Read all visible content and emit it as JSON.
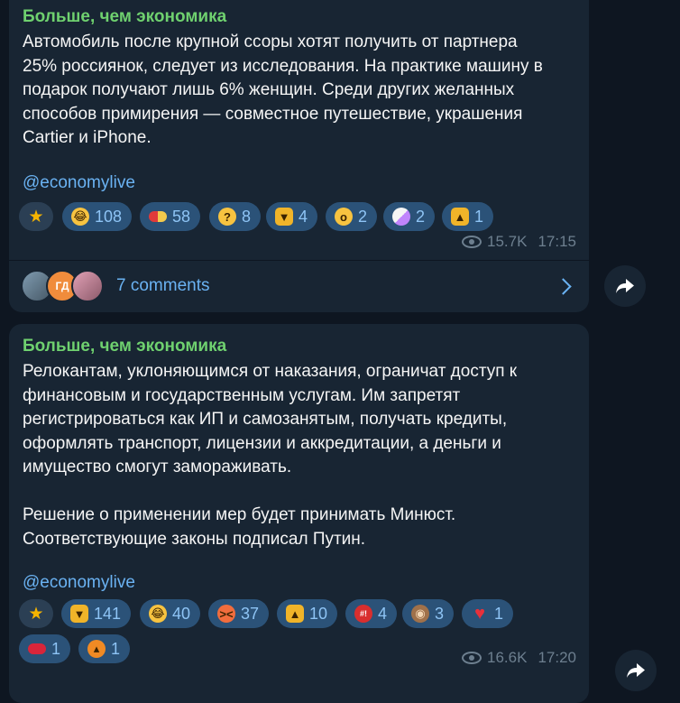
{
  "messages": [
    {
      "sender": "Больше, чем экономика",
      "text": "Автомобиль после крупной ссоры хотят получить от партнера\n25% россиянок, следует из исследования. На практике машину в\nподарок получают лишь 6% женщин. Среди других желанных\nспособов примирения — совместное путешествие, украшения\nCartier и iPhone.",
      "link": "@economylive",
      "reactions": [
        {
          "icon": "star-icon",
          "count": ""
        },
        {
          "icon": "rofl-emoji-icon",
          "count": "108"
        },
        {
          "icon": "pill-emoji-icon",
          "count": "58"
        },
        {
          "icon": "thinking-emoji-icon",
          "count": "8"
        },
        {
          "icon": "thumbs-down-emoji-icon",
          "count": "4"
        },
        {
          "icon": "yawning-emoji-icon",
          "count": "2"
        },
        {
          "icon": "unicorn-emoji-icon",
          "count": "2"
        },
        {
          "icon": "thumbs-up-emoji-icon",
          "count": "1"
        }
      ],
      "views": "15.7K",
      "time": "17:15",
      "comments": {
        "label": "7 comments",
        "avatars": [
          "",
          "ГД",
          ""
        ]
      }
    },
    {
      "sender": "Больше, чем экономика",
      "text": "Релокантам, уклоняющимся от наказания, ограничат доступ к\nфинансовым и государственным услугам. Им запретят\nрегистрироваться как ИП и самозанятым, получать кредиты,\nоформлять транспорт, лицензии и аккредитации, а деньги и\nимущество смогут замораживать.\n\nРешение о применении мер будет принимать Минюст.\nСоответствующие законы подписал Путин.",
      "link": "@economylive",
      "reactions": [
        {
          "icon": "star-icon",
          "count": ""
        },
        {
          "icon": "thumbs-down-emoji-icon",
          "count": "141"
        },
        {
          "icon": "rofl-emoji-icon",
          "count": "40"
        },
        {
          "icon": "angry-emoji-icon",
          "count": "37"
        },
        {
          "icon": "thumbs-up-emoji-icon",
          "count": "10"
        },
        {
          "icon": "cursing-emoji-icon",
          "count": "4"
        },
        {
          "icon": "see-no-evil-monkey-emoji-icon",
          "count": "3"
        },
        {
          "icon": "heart-emoji-icon",
          "count": "1"
        },
        {
          "icon": "kiss-lips-emoji-icon",
          "count": "1"
        },
        {
          "icon": "pumpkin-emoji-icon",
          "count": "1"
        }
      ],
      "views": "16.6K",
      "time": "17:20"
    }
  ],
  "colors": {
    "background": "#0e1621",
    "bubble": "#182533",
    "sender": "#6fd16f",
    "link": "#6ab2f2",
    "reaction_bg": "#2b5278",
    "meta": "#6d7f8f"
  }
}
